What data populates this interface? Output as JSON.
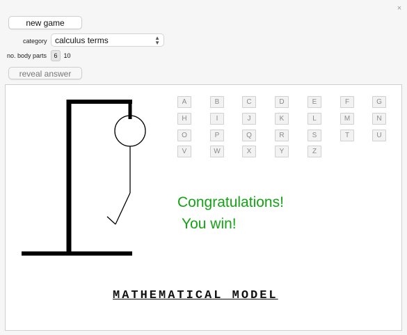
{
  "window": {
    "close_glyph": "×",
    "close_icon": "close-icon"
  },
  "controls": {
    "new_game_label": "new game",
    "category_label": "category",
    "category_value": "calculus terms",
    "body_parts_label": "no. body parts",
    "body_parts_options": [
      "6",
      "10"
    ],
    "body_parts_selected": "6",
    "reveal_label": "reveal answer"
  },
  "game": {
    "letters": [
      [
        "A",
        "B",
        "C",
        "D",
        "E",
        "F",
        "G"
      ],
      [
        "H",
        "I",
        "J",
        "K",
        "L",
        "M",
        "N"
      ],
      [
        "O",
        "P",
        "Q",
        "R",
        "S",
        "T",
        "U"
      ],
      [
        "V",
        "W",
        "X",
        "Y",
        "Z"
      ]
    ],
    "message_line1": "Congratulations!",
    "message_line2": "You win!",
    "word": "MATHEMATICAL MODEL",
    "colors": {
      "win": "#13a313",
      "used_letter_bg": "#f2f2f2",
      "used_letter_text": "#8a8a8a"
    }
  }
}
